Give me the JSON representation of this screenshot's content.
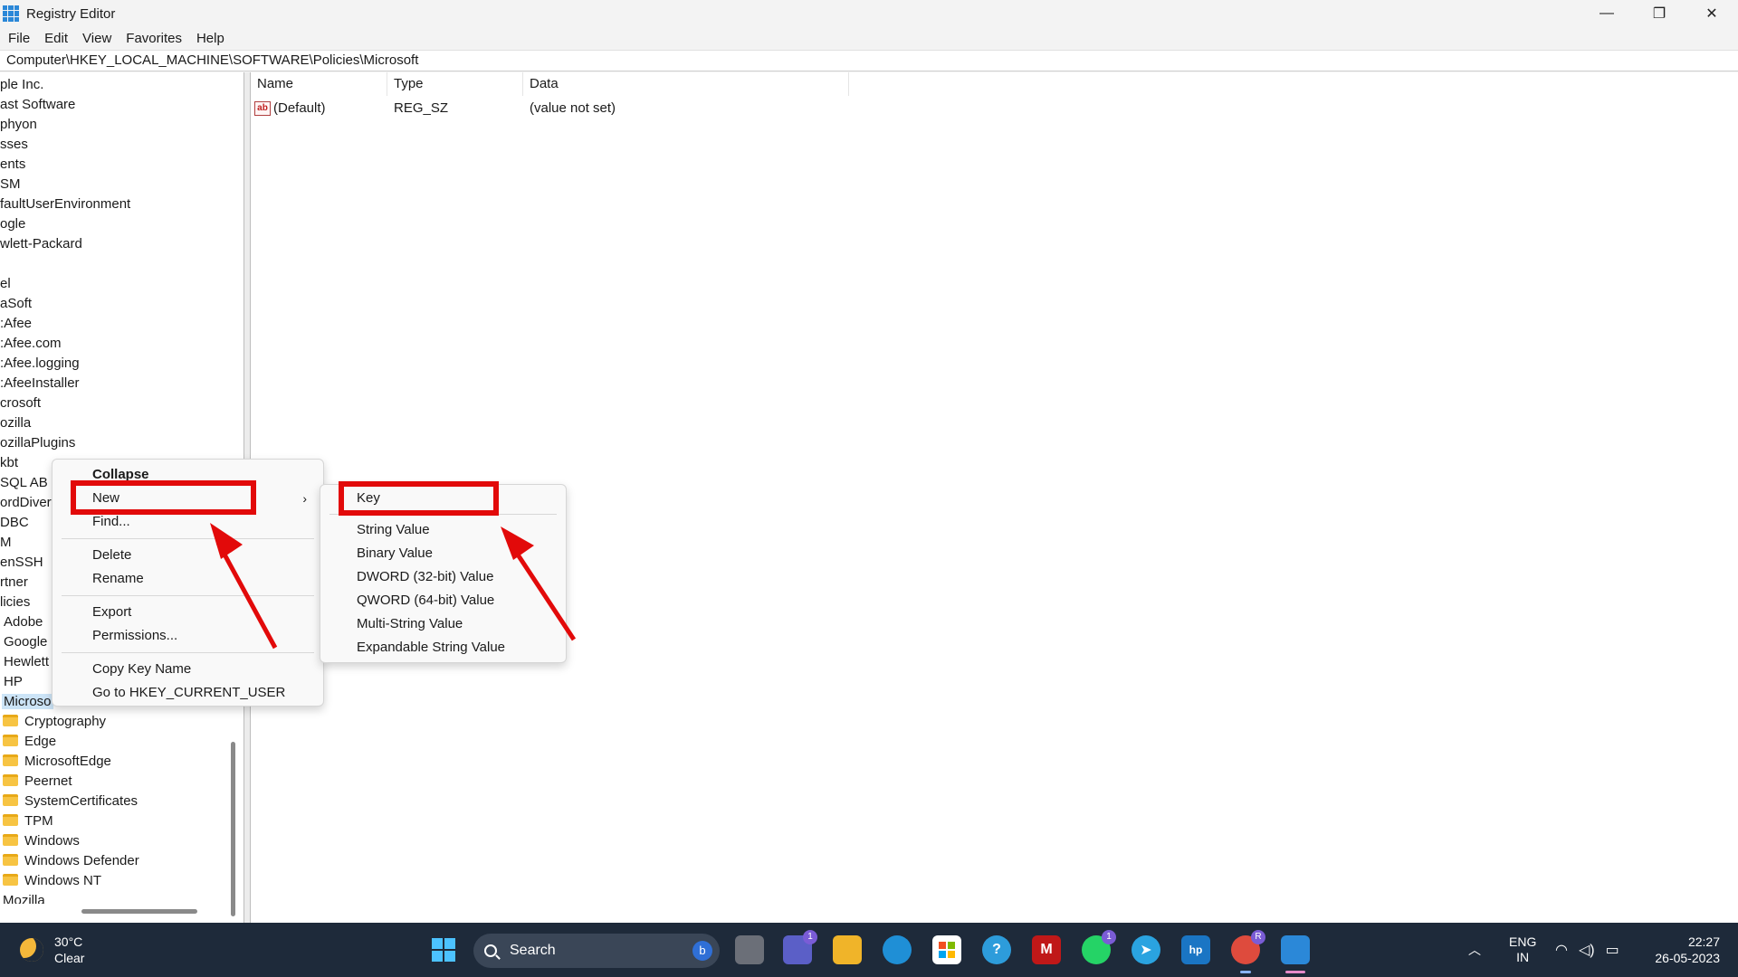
{
  "window": {
    "title": "Registry Editor",
    "controls": {
      "minimize": "—",
      "maximize": "❐",
      "close": "✕"
    }
  },
  "menu": [
    "File",
    "Edit",
    "View",
    "Favorites",
    "Help"
  ],
  "address": "Computer\\HKEY_LOCAL_MACHINE\\SOFTWARE\\Policies\\Microsoft",
  "tree": {
    "items": [
      "ple Inc.",
      "ast Software",
      "phyon",
      "sses",
      "ents",
      "SM",
      "faultUserEnvironment",
      "ogle",
      "wlett-Packard",
      "",
      "el",
      "aSoft",
      ":Afee",
      ":Afee.com",
      ":Afee.logging",
      ":AfeeInstaller",
      "crosoft",
      "ozilla",
      "ozillaPlugins",
      "kbt",
      "SQL AB",
      "ordDivert",
      "DBC",
      "M",
      "enSSH",
      "rtner",
      "licies",
      "Adobe",
      "Google",
      "Hewlett",
      "HP",
      "Microso"
    ],
    "folders": [
      "Cryptography",
      "Edge",
      "MicrosoftEdge",
      "Peernet",
      "SystemCertificates",
      "TPM",
      "Windows",
      "Windows Defender",
      "Windows NT",
      "Mozilla"
    ]
  },
  "list": {
    "columns": [
      "Name",
      "Type",
      "Data"
    ],
    "rows": [
      {
        "name": "(Default)",
        "type": "REG_SZ",
        "data": "(value not set)",
        "icon": "string-value-icon"
      }
    ]
  },
  "context_menu": {
    "items": [
      "Collapse",
      "New",
      "Find...",
      "Delete",
      "Rename",
      "Export",
      "Permissions...",
      "Copy Key Name",
      "Go to HKEY_CURRENT_USER"
    ]
  },
  "submenu": {
    "items": [
      "Key",
      "String Value",
      "Binary Value",
      "DWORD (32-bit) Value",
      "QWORD (64-bit) Value",
      "Multi-String Value",
      "Expandable String Value"
    ]
  },
  "annotations": {
    "highlight_color": "#e20a0a"
  },
  "taskbar": {
    "weather_temp": "30°C",
    "weather_desc": "Clear",
    "search_placeholder": "Search",
    "badges": {
      "teams": "1",
      "whatsapp": "1",
      "chrome": "R"
    },
    "lang": "ENG",
    "region": "IN",
    "time": "22:27",
    "date": "26-05-2023"
  }
}
